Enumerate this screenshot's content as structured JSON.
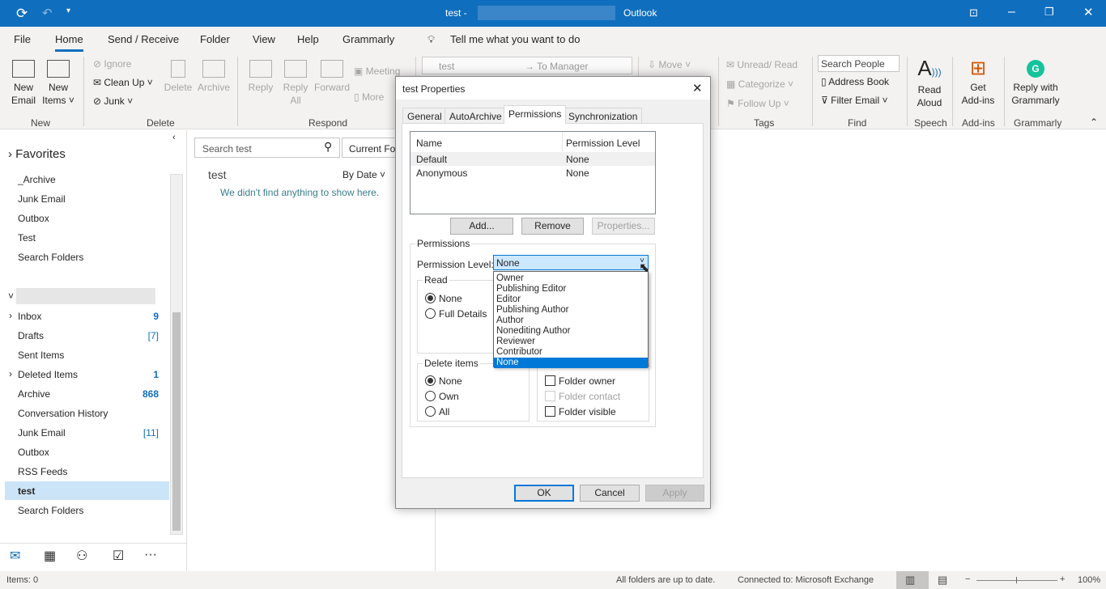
{
  "titlebar": {
    "title_prefix": "test -",
    "app": "Outlook"
  },
  "menu": {
    "tabs": [
      "File",
      "Home",
      "Send / Receive",
      "Folder",
      "View",
      "Help",
      "Grammarly"
    ],
    "active": "Home",
    "tell_me": "Tell me what you want to do"
  },
  "ribbon": {
    "new": {
      "new_email": "New\nEmail",
      "new_items": "New\nItems ˅",
      "label": "New"
    },
    "delete": {
      "ignore": "Ignore",
      "clean_up": "Clean Up ˅",
      "junk": "Junk ˅",
      "delete": "Delete",
      "archive": "Archive",
      "label": "Delete"
    },
    "respond": {
      "reply": "Reply",
      "reply_all": "Reply\nAll",
      "forward": "Forward",
      "meeting": "Meeting",
      "more": "More",
      "label": "Respond"
    },
    "quick_steps": {
      "step1": "test",
      "step2": "To Manager"
    },
    "move": {
      "move": "Move ˅"
    },
    "tags": {
      "unread_read": "Unread/ Read",
      "categorize": "Categorize ˅",
      "follow_up": "Follow Up ˅",
      "label": "Tags"
    },
    "find": {
      "search_people_placeholder": "Search People",
      "address_book": "Address Book",
      "filter_email": "Filter Email ˅",
      "label": "Find"
    },
    "speech": {
      "read_aloud": "Read\nAloud",
      "label": "Speech"
    },
    "addins": {
      "get_addins": "Get\nAdd-ins",
      "label": "Add-ins"
    },
    "grammarly": {
      "reply": "Reply with\nGrammarly",
      "label": "Grammarly"
    }
  },
  "folders": {
    "favorites_header": "Favorites",
    "favorites": [
      "_Archive",
      "Junk Email",
      "Outbox",
      "Test",
      "Search Folders"
    ],
    "items": [
      {
        "name": "Inbox",
        "count": "9",
        "expand": true
      },
      {
        "name": "Drafts",
        "count": "[7]"
      },
      {
        "name": "Sent Items",
        "count": ""
      },
      {
        "name": "Deleted Items",
        "count": "1",
        "expand": true
      },
      {
        "name": "Archive",
        "count": "868"
      },
      {
        "name": "Conversation History",
        "count": ""
      },
      {
        "name": "Junk Email",
        "count": "[11]"
      },
      {
        "name": "Outbox",
        "count": ""
      },
      {
        "name": "RSS Feeds",
        "count": ""
      },
      {
        "name": "test",
        "count": "",
        "selected": true
      },
      {
        "name": "Search Folders",
        "count": ""
      }
    ]
  },
  "msglist": {
    "search_placeholder": "Search test",
    "scope": "Current Fol",
    "folder": "test",
    "sort": "By Date ˅",
    "empty": "We didn't find anything to show here."
  },
  "status": {
    "items": "Items: 0",
    "sync": "All folders are up to date.",
    "connection": "Connected to: Microsoft Exchange",
    "zoom": "100%"
  },
  "dialog": {
    "title": "test Properties",
    "tabs": [
      "General",
      "AutoArchive",
      "Permissions",
      "Synchronization"
    ],
    "active_tab": "Permissions",
    "columns": [
      "Name",
      "Permission Level"
    ],
    "rows": [
      [
        "Default",
        "None"
      ],
      [
        "Anonymous",
        "None"
      ]
    ],
    "add": "Add...",
    "remove": "Remove",
    "properties": "Properties...",
    "permissions_group": "Permissions",
    "permission_level_label": "Permission Level:",
    "permission_level": "None",
    "options": [
      "Owner",
      "Publishing Editor",
      "Editor",
      "Publishing Author",
      "Author",
      "Nonediting Author",
      "Reviewer",
      "Contributor",
      "None"
    ],
    "read_group": "Read",
    "read_options": [
      "None",
      "Full Details"
    ],
    "delete_group": "Delete items",
    "delete_options": [
      "None",
      "Own",
      "All"
    ],
    "checks": [
      "Folder owner",
      "Folder contact",
      "Folder visible"
    ],
    "ok": "OK",
    "cancel": "Cancel",
    "apply": "Apply"
  },
  "colors": {
    "accent": "#106ebe",
    "selection": "#0078d7",
    "selected_folder": "#cce4f7"
  }
}
